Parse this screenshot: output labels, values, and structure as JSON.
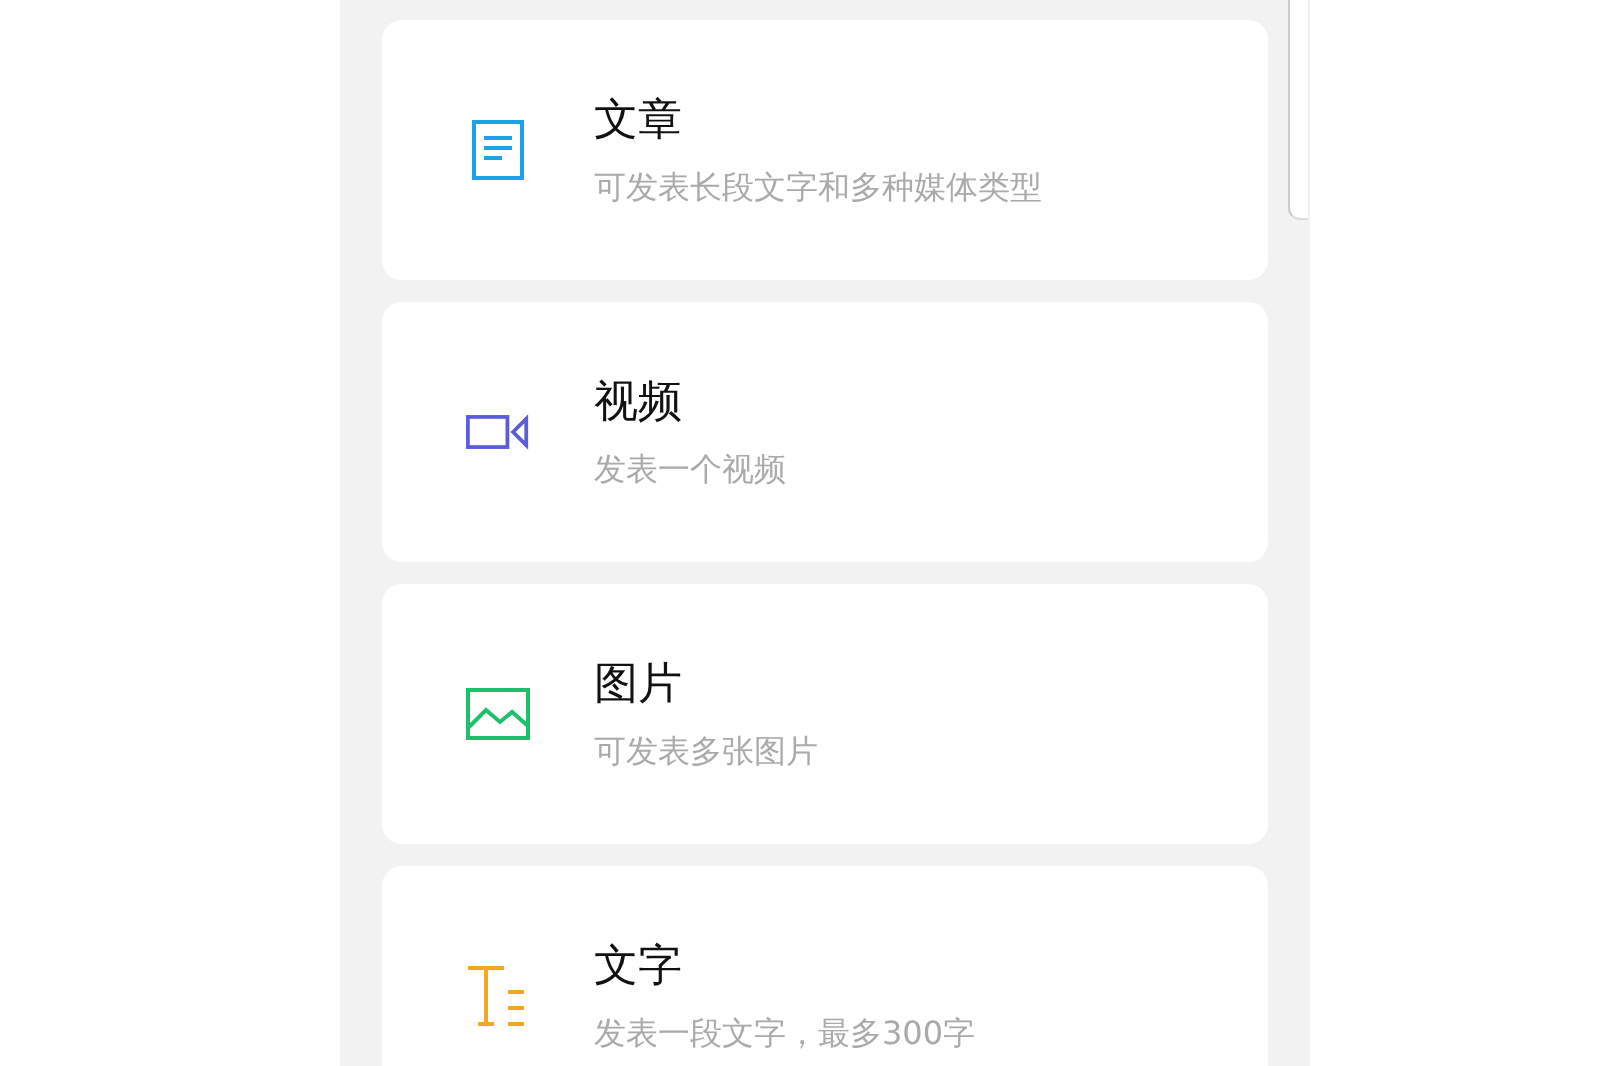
{
  "options": [
    {
      "kind": "article",
      "title": "文章",
      "description": "可发表长段文字和多种媒体类型"
    },
    {
      "kind": "video",
      "title": "视频",
      "description": "发表一个视频"
    },
    {
      "kind": "image",
      "title": "图片",
      "description": "可发表多张图片"
    },
    {
      "kind": "text",
      "title": "文字",
      "description": "发表一段文字，最多300字"
    }
  ]
}
